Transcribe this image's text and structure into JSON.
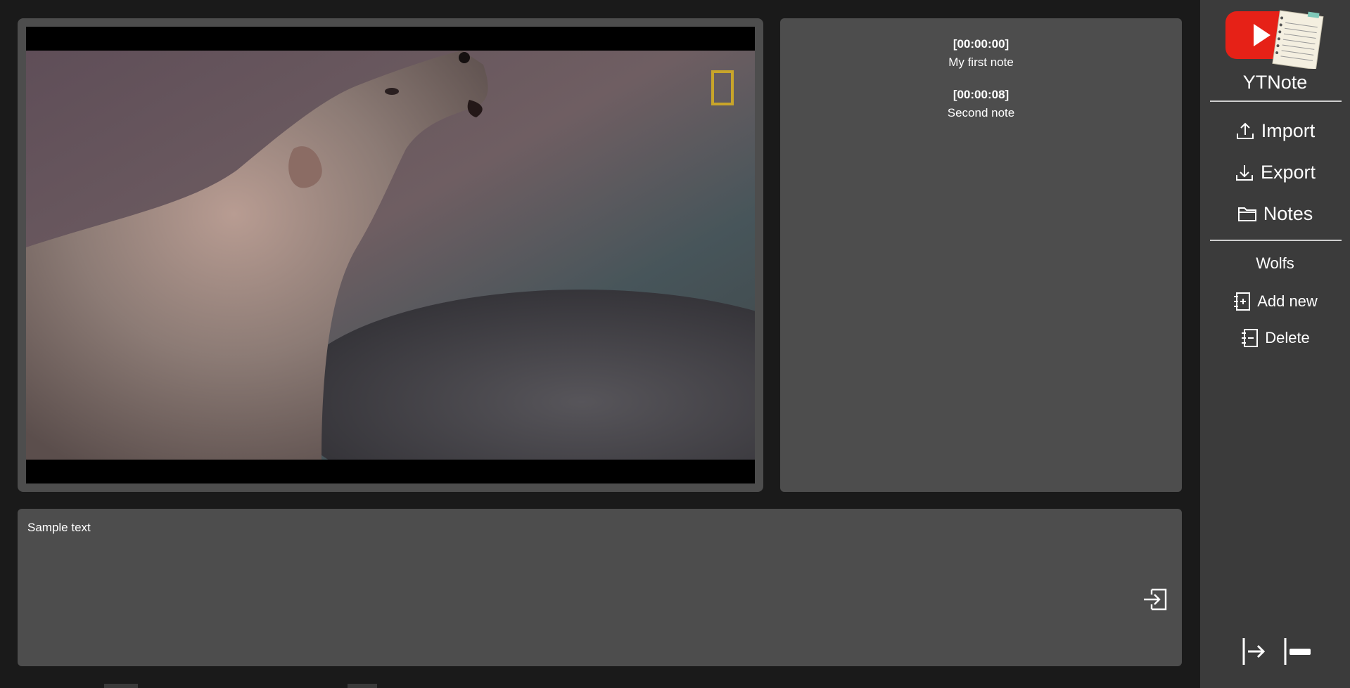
{
  "app": {
    "title": "YTNote"
  },
  "notes": [
    {
      "time": "[00:00:00]",
      "text": "My first note"
    },
    {
      "time": "[00:00:08]",
      "text": "Second note"
    }
  ],
  "editor": {
    "value": "Sample text"
  },
  "sidebar": {
    "import_label": "Import",
    "export_label": "Export",
    "notes_label": "Notes",
    "collection_name": "Wolfs",
    "add_new_label": "Add new",
    "delete_label": "Delete"
  },
  "colors": {
    "background": "#1a1a1a",
    "panel": "#4d4d4d",
    "sidebar": "#3b3b3b",
    "youtube_red": "#e62117",
    "natgeo_yellow": "#c8a52a"
  },
  "icons": [
    "upload-icon",
    "download-icon",
    "folder-icon",
    "notebook-plus-icon",
    "notebook-minus-icon",
    "enter-icon",
    "arrow-right-bar-icon",
    "bar-minus-icon"
  ]
}
